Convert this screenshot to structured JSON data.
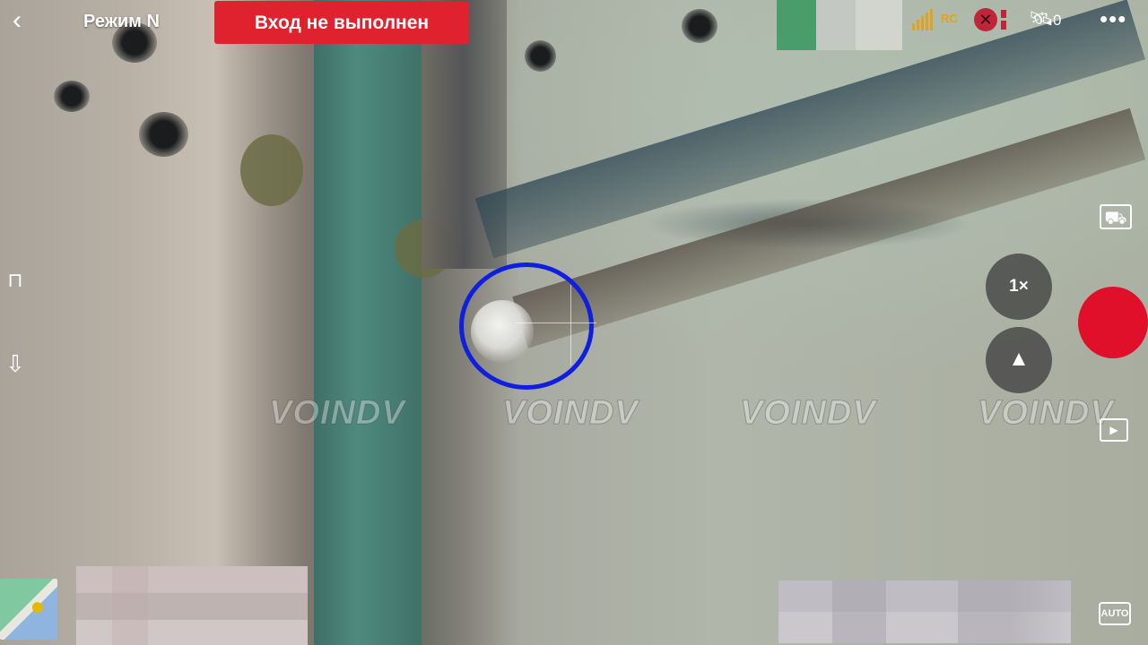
{
  "hud": {
    "back_icon": "chevron-left-icon",
    "mode_label": "Режим N",
    "login_status": "Вход не выполнен",
    "rc_signal_label": "RC",
    "satellite_count": "0",
    "more_icon": "ellipsis-icon"
  },
  "watermarks": [
    "VOINDV",
    "VOINDV",
    "VOINDV",
    "VOINDV"
  ],
  "right_controls": {
    "zoom_label": "1×",
    "auto_label": "AUTO",
    "icons": [
      "truck-icon",
      "mountain-icon",
      "record-icon",
      "playback-icon"
    ]
  },
  "left_controls": {
    "icons": [
      "obstacle-icon",
      "return-home-icon",
      "map-thumbnail-icon"
    ]
  },
  "colors": {
    "login_banner": "#e0222f",
    "record_button": "#e0102a",
    "target_ring": "#0f1fe0",
    "signal": "#e2a21a"
  }
}
